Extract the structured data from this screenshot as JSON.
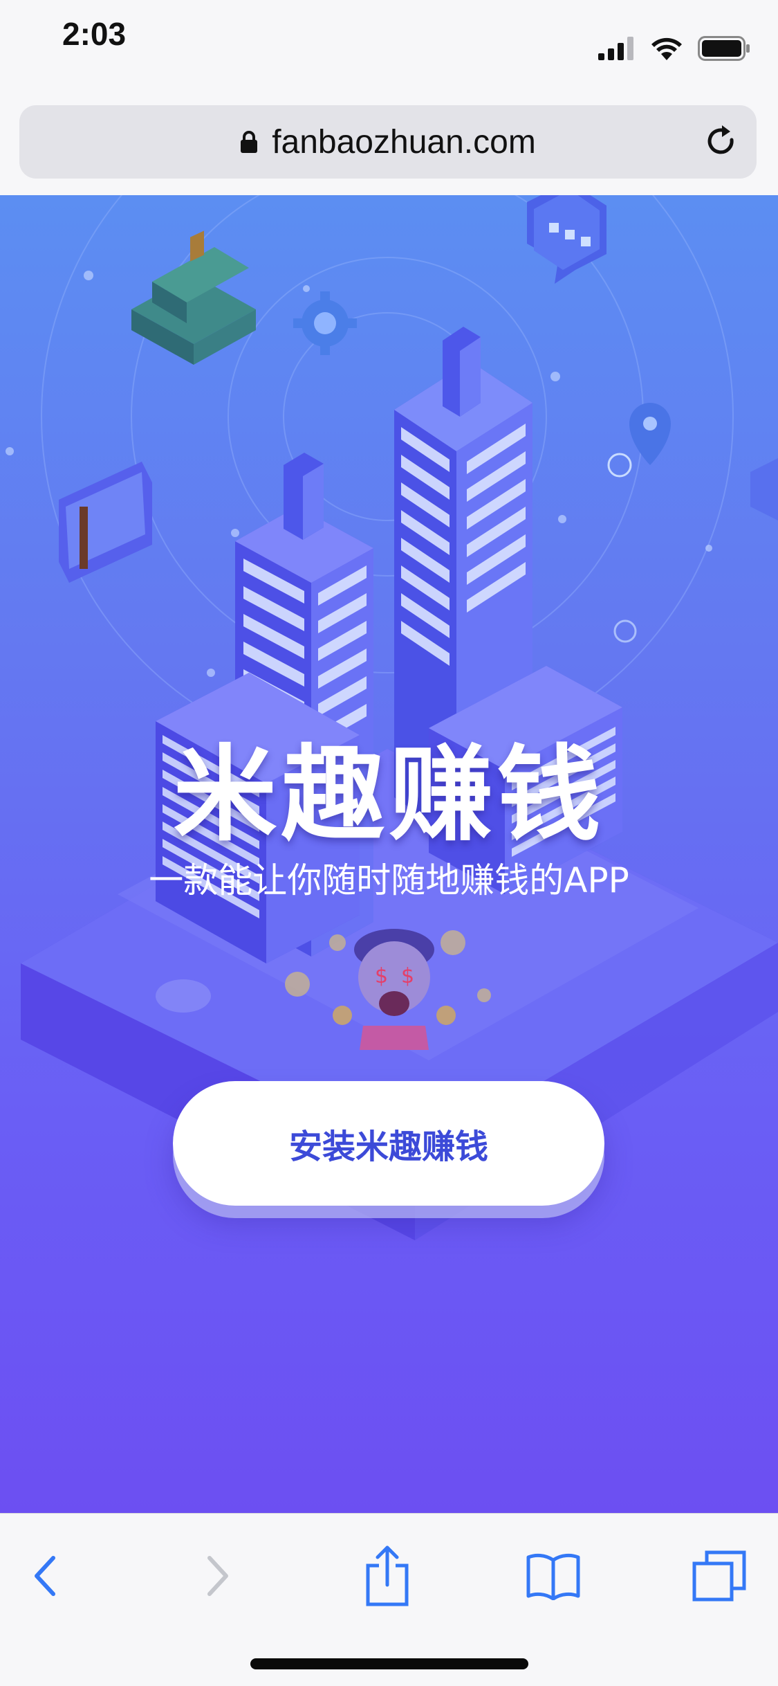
{
  "status_bar": {
    "time": "2:03",
    "signal_icon": "cellular-signal-icon",
    "wifi_icon": "wifi-icon",
    "battery_icon": "battery-icon"
  },
  "browser": {
    "url": "fanbaozhuan.com",
    "lock_icon": "lock-icon",
    "reload_icon": "reload-icon"
  },
  "hero": {
    "title": "米趣赚钱",
    "subtitle": "一款能让你随时随地赚钱的APP",
    "install_button_label": "安装米趣赚钱",
    "background_gradient": [
      "#5c8ef2",
      "#6c4ff2"
    ]
  },
  "toolbar": {
    "back_icon": "chevron-left-icon",
    "forward_icon": "chevron-right-icon",
    "share_icon": "share-icon",
    "bookmarks_icon": "book-icon",
    "tabs_icon": "tabs-icon"
  },
  "colors": {
    "accent": "#3478f6",
    "button_text": "#3c4ad8"
  }
}
